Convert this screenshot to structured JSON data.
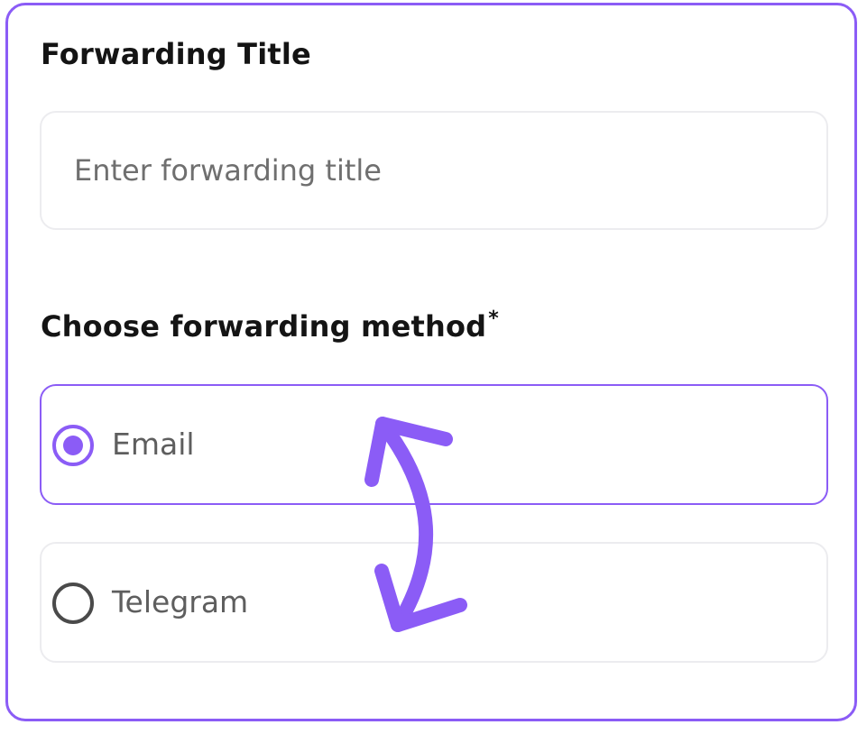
{
  "form": {
    "title_label": "Forwarding Title",
    "title_placeholder": "Enter forwarding title",
    "title_value": "",
    "method_label": "Choose forwarding method",
    "required_mark": "*",
    "options": [
      {
        "label": "Email",
        "selected": true
      },
      {
        "label": "Telegram",
        "selected": false
      }
    ]
  },
  "colors": {
    "accent": "#8b5cf6",
    "border": "#ececef",
    "text": "#141414",
    "muted_text": "#5e5e5e"
  },
  "icons": {
    "annotation": "double-headed-curved-arrow-icon"
  }
}
